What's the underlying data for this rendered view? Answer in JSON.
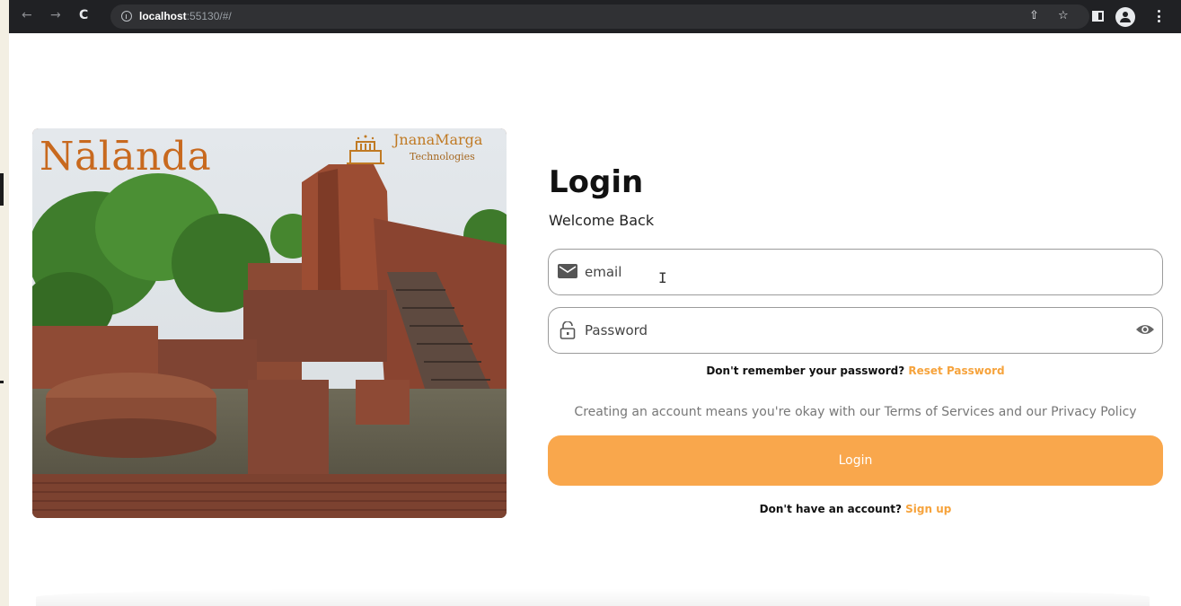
{
  "browser": {
    "url_host": "localhost",
    "url_rest": ":55130/#/"
  },
  "hero": {
    "title": "Nālānda",
    "logo_name": "JnanaMarga",
    "logo_sub": "Technologies"
  },
  "login": {
    "title": "Login",
    "subtitle": "Welcome Back",
    "email_placeholder": "email",
    "password_placeholder": "Password",
    "forgot_text": "Don't remember your password?",
    "reset_link": "Reset Password",
    "terms_text": "Creating an account means you're okay with our Terms of Services and our Privacy Policy",
    "login_button": "Login",
    "no_account_text": "Don't have an account?",
    "signup_link": "Sign up"
  },
  "colors": {
    "accent": "#f9a74c",
    "link": "#f6a33c",
    "chrome_bg": "#202124",
    "hero_title": "#c8691e"
  },
  "icons": [
    "back-icon",
    "forward-icon",
    "reload-icon",
    "info-icon",
    "share-icon",
    "bookmark-star-icon",
    "side-panel-icon",
    "profile-icon",
    "menu-icon",
    "mail-icon",
    "lock-icon",
    "eye-icon"
  ]
}
